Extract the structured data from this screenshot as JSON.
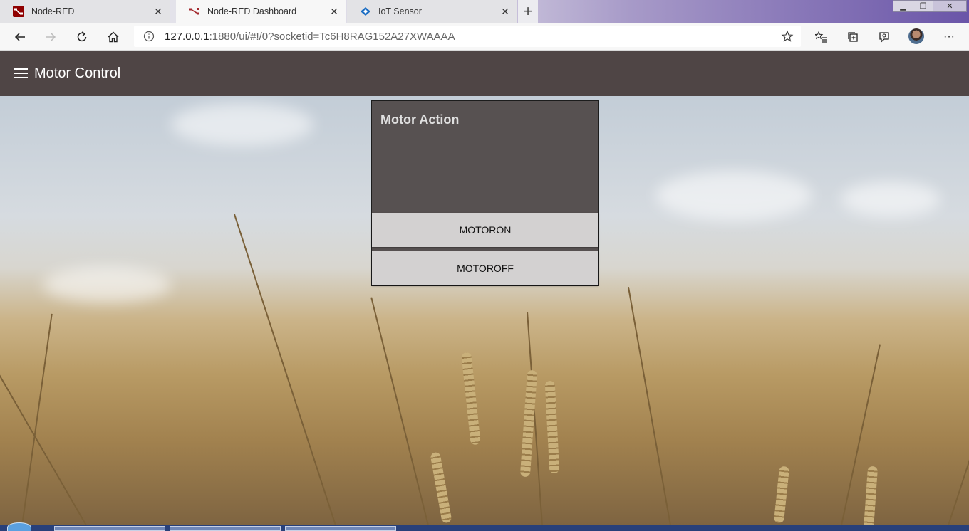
{
  "browser": {
    "tabs": [
      {
        "title": "Node-RED",
        "icon": "node-red-icon",
        "active": false
      },
      {
        "title": "Node-RED Dashboard",
        "icon": "node-red-flow-icon",
        "active": true
      },
      {
        "title": "IoT Sensor",
        "icon": "iot-sensor-icon",
        "active": false
      }
    ],
    "url_host": "127.0.0.1",
    "url_rest": ":1880/ui/#!/0?socketid=Tc6H8RAG152A27XWAAAA"
  },
  "dashboard": {
    "title": "Motor Control",
    "header_color": "#4f4545",
    "group": {
      "title": "Motor Action",
      "buttons": [
        {
          "label": "MOTORON"
        },
        {
          "label": "MOTOROFF"
        }
      ]
    }
  }
}
